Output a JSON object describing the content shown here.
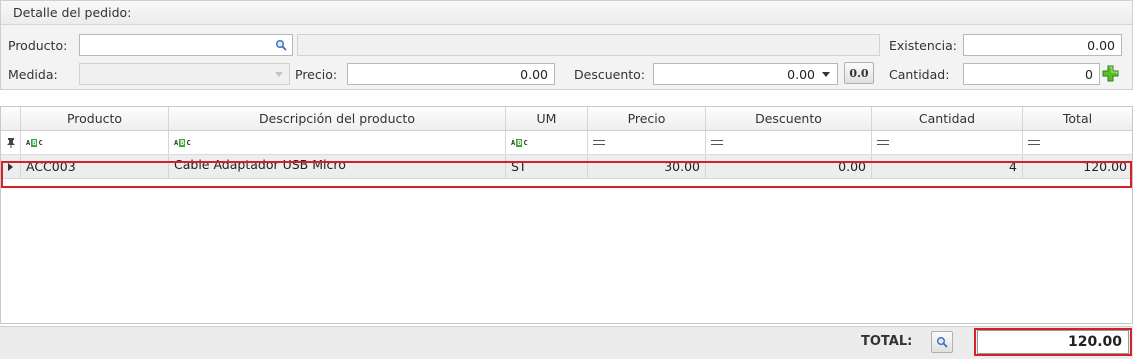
{
  "panel": {
    "title": "Detalle del pedido:"
  },
  "form": {
    "producto_label": "Producto:",
    "producto_value": "",
    "descripcion_value": "",
    "existencia_label": "Existencia:",
    "existencia_value": "0.00",
    "medida_label": "Medida:",
    "medida_value": "",
    "precio_label": "Precio:",
    "precio_value": "0.00",
    "descuento_label": "Descuento:",
    "descuento_value": "0.00",
    "descuento_btn": "0.0",
    "cantidad_label": "Cantidad:",
    "cantidad_value": "0"
  },
  "grid": {
    "columns": [
      "Producto",
      "Descripción del producto",
      "UM",
      "Precio",
      "Descuento",
      "Cantidad",
      "Total"
    ],
    "rows": [
      {
        "producto": "ACC003",
        "descripcion": "Cable Adaptador USB Micro",
        "um": "ST",
        "precio": "30.00",
        "descuento": "0.00",
        "cantidad": "4",
        "total": "120.00"
      }
    ]
  },
  "footer": {
    "total_label": "TOTAL:",
    "total_value": "120.00"
  },
  "colors": {
    "highlight": "#d4202a",
    "add_icon": "#4caf27"
  },
  "icons": [
    "search-icon",
    "dropdown-arrow-icon",
    "add-icon",
    "pin-icon",
    "abc-filter-icon",
    "equals-filter-icon",
    "row-indicator-icon"
  ]
}
